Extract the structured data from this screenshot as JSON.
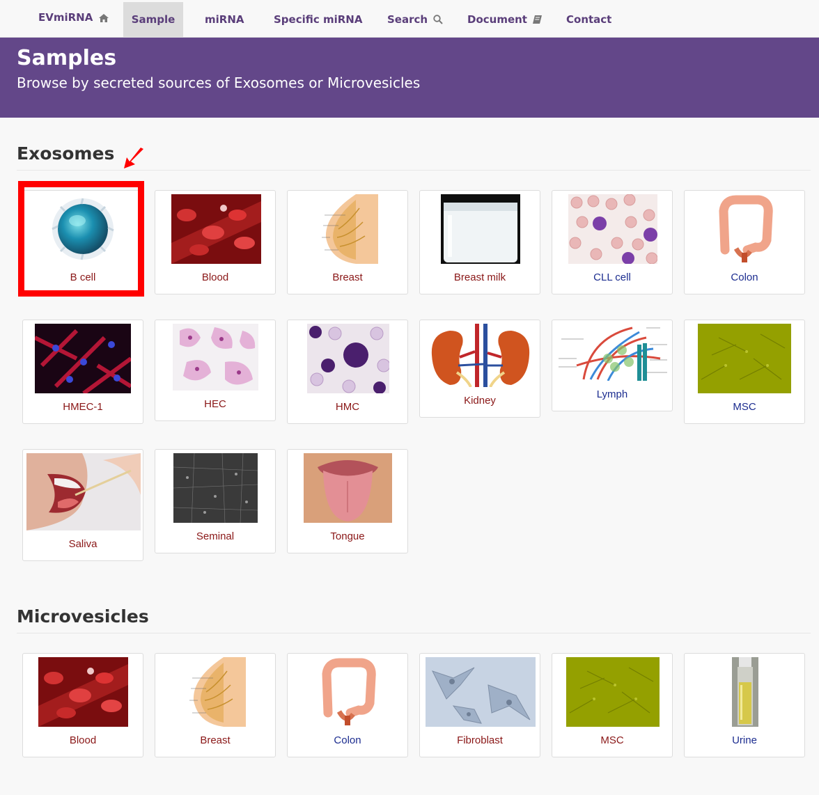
{
  "nav": {
    "brand": "EVmiRNA",
    "items": [
      "Sample",
      "miRNA",
      "Specific miRNA",
      "Search",
      "Document",
      "Contact"
    ]
  },
  "header": {
    "title": "Samples",
    "subtitle": "Browse by secreted sources of Exosomes or Microvesicles"
  },
  "exosomes": {
    "title": "Exosomes",
    "cards": [
      "B cell",
      "Blood",
      "Breast",
      "Breast milk",
      "CLL cell",
      "Colon",
      "HMEC-1",
      "HEC",
      "HMC",
      "Kidney",
      "Lymph",
      "MSC",
      "Saliva",
      "Seminal",
      "Tongue"
    ]
  },
  "microvesicles": {
    "title": "Microvesicles",
    "cards": [
      "Blood",
      "Breast",
      "Colon",
      "Fibroblast",
      "MSC",
      "Urine"
    ]
  },
  "colors": {
    "primary": "#634789",
    "label_red": "#8a1717",
    "label_blue": "#1b2c8f",
    "highlight": "#ff0000"
  }
}
